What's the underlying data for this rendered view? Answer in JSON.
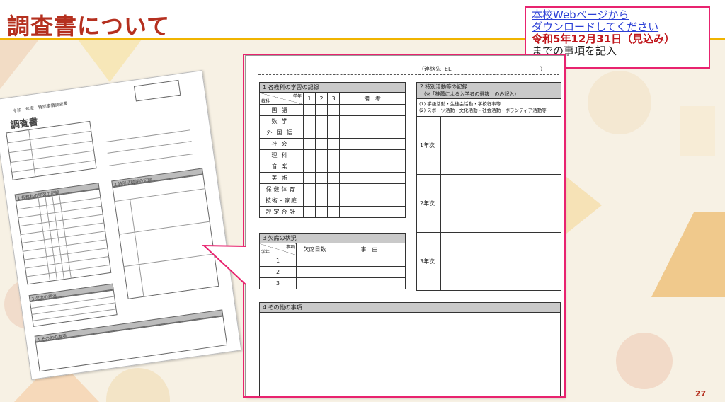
{
  "slide": {
    "title": "調査書について",
    "page_number": "27"
  },
  "callout": {
    "line1": "本校Webページから",
    "line2": "ダウンロードしてください",
    "line3": "令和5年12月31日（見込み）",
    "line4": "までの事項を記入"
  },
  "form_zoom": {
    "contact": "（連絡先TEL",
    "contact_close": "）",
    "sec1": {
      "title": "1 各教科の学習の記録",
      "corner_top": "学年",
      "corner_bottom": "教科",
      "years": [
        "1",
        "2",
        "3"
      ],
      "remarks": "備　考",
      "subjects": [
        "国語",
        "数学",
        "外国語",
        "社会",
        "理科",
        "音楽",
        "美術",
        "保健体育",
        "技術・家庭",
        "評定合計"
      ]
    },
    "sec2": {
      "title": "2 特別活動等の記録",
      "note": "(※「推薦による入学者の選抜」のみ記入)",
      "item1": "(1) 学級活動・生徒会活動・学校行事等",
      "item2": "(2) スポーツ活動・文化活動・社会活動・ボランティア活動等",
      "rows": [
        "1年次",
        "2年次",
        "3年次"
      ]
    },
    "sec3": {
      "title": "3 欠席の状況",
      "corner_top": "事項",
      "corner_bottom": "学年",
      "col_days": "欠席日数",
      "col_reason": "事　由",
      "rows": [
        "1",
        "2",
        "3"
      ]
    },
    "sec4": {
      "title": "4 その他の事項"
    }
  },
  "form_thumbnail": {
    "title": "調査書",
    "header_small": "令和　年度　特別事情調査書",
    "sec1": "1 各教科の学習の記録",
    "sec2": "2 特別活動等の記録",
    "sec3": "3 欠席の状況",
    "sec4": "4 その他の事項"
  },
  "colors": {
    "title": "#b5301f",
    "accent_rule": "#f0b400",
    "callout_border": "#e8236f",
    "link": "#2b3fd6",
    "date": "#c0161c"
  }
}
